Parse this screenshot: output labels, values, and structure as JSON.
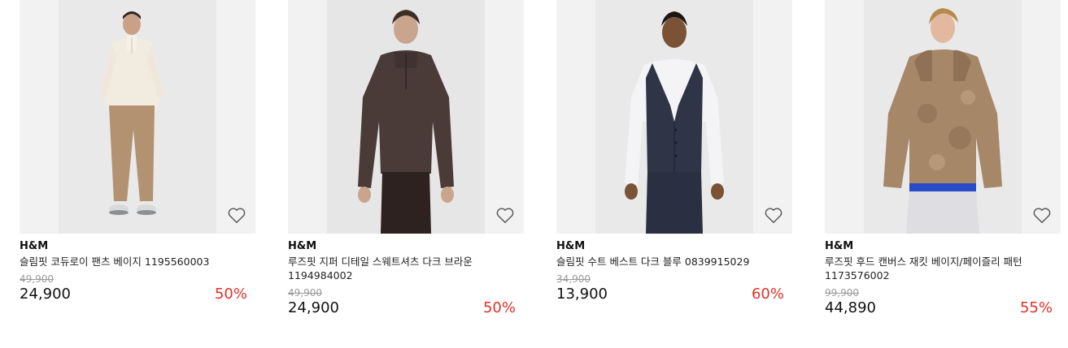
{
  "products": [
    {
      "brand": "H&M",
      "name": "슬림핏 코듀로이 팬츠 베이지 1195560003",
      "original_price": "49,900",
      "sale_price": "24,900",
      "discount": "50%",
      "wishlist_icon": "heart-outline-icon"
    },
    {
      "brand": "H&M",
      "name": "루즈핏 지퍼 디테일 스웨트셔츠 다크 브라운 1194984002",
      "original_price": "49,900",
      "sale_price": "24,900",
      "discount": "50%",
      "wishlist_icon": "heart-outline-icon"
    },
    {
      "brand": "H&M",
      "name": "슬림핏 수트 베스트 다크 블루 0839915029",
      "original_price": "34,900",
      "sale_price": "13,900",
      "discount": "60%",
      "wishlist_icon": "heart-outline-icon"
    },
    {
      "brand": "H&M",
      "name": "루즈핏 후드 캔버스 재킷 베이지/페이즐리 패턴 1173576002",
      "original_price": "99,900",
      "sale_price": "44,890",
      "discount": "55%",
      "wishlist_icon": "heart-outline-icon"
    }
  ],
  "colors": {
    "discount": "#e0302b",
    "original_price": "#9a9a9a",
    "image_background": "#f2f2f2"
  }
}
